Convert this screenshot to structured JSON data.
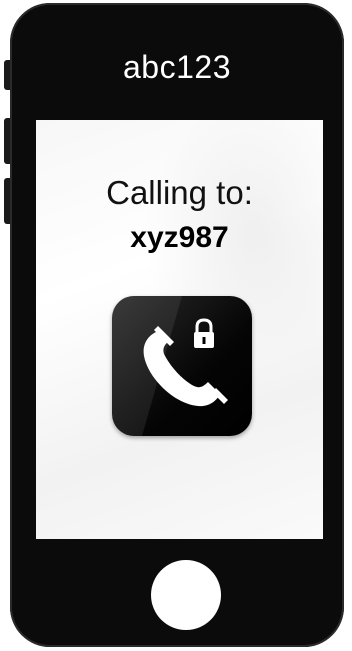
{
  "phone": {
    "caller_id": "abc123"
  },
  "call": {
    "calling_label": "Calling to:",
    "callee_id": "xyz987"
  },
  "icons": {
    "call_app": "secure-phone-icon",
    "handset": "phone-handset-icon",
    "lock": "lock-icon",
    "home": "home-button"
  },
  "colors": {
    "phone_body": "#0b0b0b",
    "screen": "#ffffff",
    "app_icon_bg": "#000000",
    "icon_glyph": "#ffffff"
  }
}
